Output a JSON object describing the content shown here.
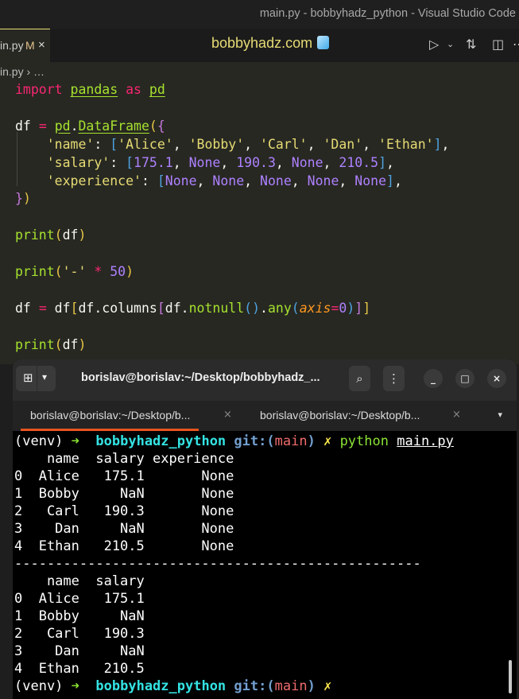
{
  "window": {
    "title": "main.py - bobbyhadz_python - Visual Studio Code"
  },
  "editor_tab": {
    "name": "in.py",
    "modified_badge": "M",
    "close": "×"
  },
  "brand": {
    "text": "bobbyhadz.com"
  },
  "toolbar": {
    "run": "▷",
    "run_dropdown": "⌄",
    "compare": "⇅",
    "split": "◫",
    "more": "⋯"
  },
  "breadcrumb": {
    "text": "in.py › …"
  },
  "code_lines": [
    "import pandas as pd",
    "",
    "df = pd.DataFrame({",
    "    'name': ['Alice', 'Bobby', 'Carl', 'Dan', 'Ethan'],",
    "    'salary': [175.1, None, 190.3, None, 210.5],",
    "    'experience': [None, None, None, None, None],",
    "})",
    "",
    "print(df)",
    "",
    "print('-' * 50)",
    "",
    "df = df[df.columns[df.notnull().any(axis=0)]]",
    "",
    "print(df)"
  ],
  "terminal": {
    "title": "borislav@borislav:~/Desktop/bobbyhadz_...",
    "new_tab_icon": "⊞",
    "dropdown_icon": "▾",
    "search_icon": "🔍",
    "menu_icon": "⋮",
    "minimize": "_",
    "maximize": "□",
    "close": "×",
    "tabs": [
      {
        "label": "borislav@borislav:~/Desktop/b...",
        "close": "×",
        "active": true
      },
      {
        "label": "borislav@borislav:~/Desktop/b...",
        "close": "×",
        "active": false
      }
    ],
    "prompt": {
      "venv": "(venv)",
      "arrow": "➜",
      "dir": "bobbyhadz_python",
      "git_label": "git:(",
      "branch": "main",
      "git_close": ")",
      "dirty": "✗",
      "command": "python",
      "arg": "main.py"
    },
    "output1": [
      "    name  salary experience",
      "0  Alice   175.1       None",
      "1  Bobby     NaN       None",
      "2   Carl   190.3       None",
      "3    Dan     NaN       None",
      "4  Ethan   210.5       None"
    ],
    "separator": "--------------------------------------------------",
    "output2": [
      "    name  salary",
      "0  Alice   175.1",
      "1  Bobby     NaN",
      "2   Carl   190.3",
      "3    Dan     NaN",
      "4  Ethan   210.5"
    ]
  }
}
